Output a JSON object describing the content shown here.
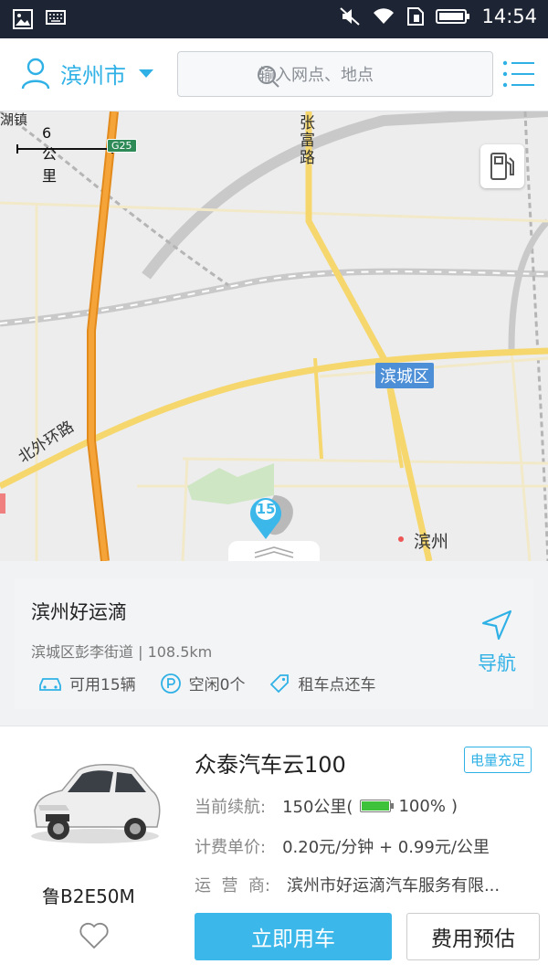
{
  "status_bar": {
    "time": "14:54"
  },
  "header": {
    "city": "滨州市",
    "search_placeholder": "输入网点、地点"
  },
  "map": {
    "scale_label": "6 公里",
    "road_tag": "G25",
    "place_labels": {
      "town": "湖镇",
      "zhangfu_road": "张富路",
      "beiwai_road": "北外环路",
      "district": "滨城区",
      "city": "滨州"
    },
    "pin_count": "15"
  },
  "station": {
    "name": "滨州好运滴",
    "address": "滨城区彭李街道 | 108.5km",
    "available": "可用15辆",
    "free_slots": "空闲0个",
    "return_policy": "租车点还车",
    "nav_label": "导航"
  },
  "car": {
    "plate": "鲁B2E50M",
    "model": "众泰汽车云100",
    "battery_badge": "电量充足",
    "range_label": "当前续航:",
    "range_value": "150公里(",
    "battery_percent": "100%",
    "battery_close": ")",
    "battery_level": 1.0,
    "price_label": "计费单价:",
    "price_value": "0.20元/分钟 + 0.99元/公里",
    "operator_label": "运  营  商:",
    "operator_value": "滨州市好运滴汽车服务有限...",
    "use_button": "立即用车",
    "estimate_button": "费用预估"
  },
  "colors": {
    "accent": "#2fb1e6",
    "battery": "#3fc23b"
  }
}
